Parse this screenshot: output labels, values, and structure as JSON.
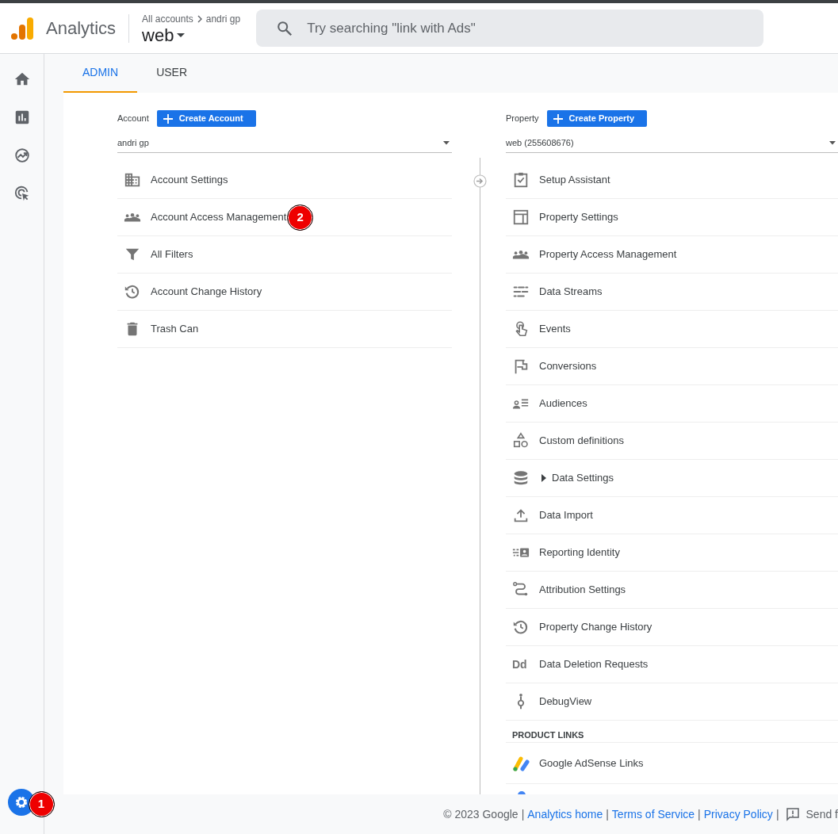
{
  "header": {
    "product": "Analytics",
    "breadcrumb": [
      "All accounts",
      "andri gp"
    ],
    "property": "web",
    "search": {
      "placeholder": "Try searching \"link with Ads\""
    }
  },
  "tabs": [
    {
      "label": "ADMIN",
      "selected": true
    },
    {
      "label": "USER",
      "selected": false
    }
  ],
  "account": {
    "label": "Account",
    "create_button": "Create Account",
    "selector": "andri gp",
    "items": [
      {
        "label": "Account Settings"
      },
      {
        "label": "Account Access Management",
        "annotation": "2"
      },
      {
        "label": "All Filters"
      },
      {
        "label": "Account Change History"
      },
      {
        "label": "Trash Can"
      }
    ]
  },
  "property": {
    "label": "Property",
    "create_button": "Create Property",
    "selector": "web (255608676)",
    "items": [
      {
        "label": "Setup Assistant"
      },
      {
        "label": "Property Settings"
      },
      {
        "label": "Property Access Management"
      },
      {
        "label": "Data Streams"
      },
      {
        "label": "Events"
      },
      {
        "label": "Conversions"
      },
      {
        "label": "Audiences"
      },
      {
        "label": "Custom definitions"
      },
      {
        "label": "Data Settings",
        "expanded": false
      },
      {
        "label": "Data Import"
      },
      {
        "label": "Reporting Identity"
      },
      {
        "label": "Attribution Settings"
      },
      {
        "label": "Property Change History"
      },
      {
        "label": "Data Deletion Requests",
        "icon_text": "Dd"
      },
      {
        "label": "DebugView"
      }
    ],
    "product_links": {
      "heading": "PRODUCT LINKS",
      "items": [
        {
          "label": "Google AdSense Links"
        }
      ]
    }
  },
  "settings_button": {
    "annotation": "1"
  },
  "footer": [
    {
      "kind": "text",
      "text": "© 2023 Google"
    },
    {
      "kind": "sep",
      "text": "|"
    },
    {
      "kind": "link",
      "text": "Analytics home"
    },
    {
      "kind": "sep",
      "text": "|"
    },
    {
      "kind": "link",
      "text": "Terms of Service"
    },
    {
      "kind": "sep",
      "text": "|"
    },
    {
      "kind": "link",
      "text": "Privacy Policy"
    },
    {
      "kind": "sep",
      "text": "|"
    },
    {
      "kind": "feedback",
      "text": "Send f"
    }
  ]
}
